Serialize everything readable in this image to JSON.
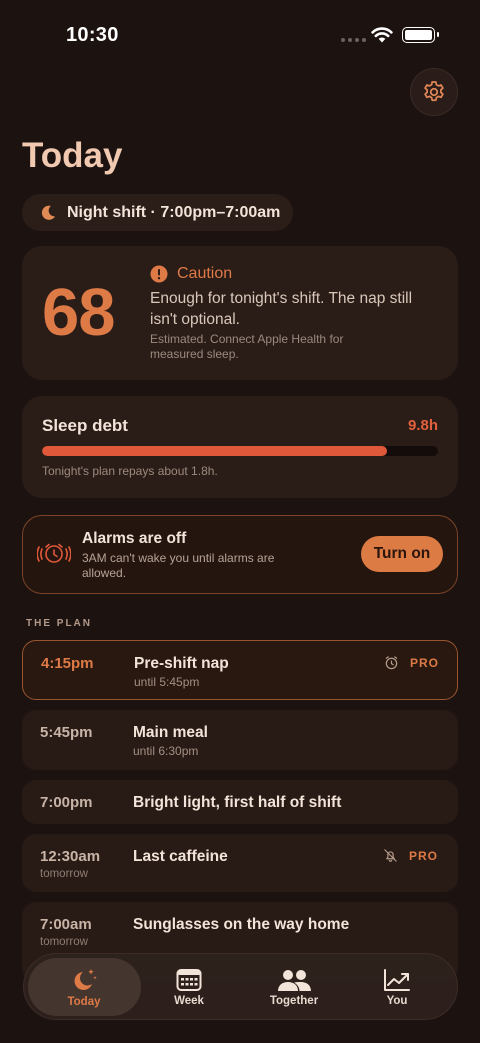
{
  "status_bar": {
    "time": "10:30"
  },
  "header": {
    "title": "Today"
  },
  "shift": {
    "label": "Night shift · 7:00pm–7:00am"
  },
  "score_card": {
    "score": "68",
    "status": "Caution",
    "message": "Enough for tonight's shift. The nap still isn't optional.",
    "note": "Estimated. Connect Apple Health for measured sleep."
  },
  "sleep_debt": {
    "title": "Sleep debt",
    "value": "9.8h",
    "fill_fraction": 0.87,
    "note": "Tonight's plan repays about 1.8h."
  },
  "alarm_banner": {
    "title": "Alarms are off",
    "description": "3AM can't wake you until alarms are allowed.",
    "button_label": "Turn on"
  },
  "plan": {
    "section_label": "THE PLAN",
    "items": [
      {
        "time": "4:15pm",
        "sub_time": "",
        "title": "Pre-shift nap",
        "until": "until 5:45pm",
        "icon": "alarm-clock-icon",
        "badge": "PRO",
        "active": true
      },
      {
        "time": "5:45pm",
        "sub_time": "",
        "title": "Main meal",
        "until": "until 6:30pm",
        "icon": "",
        "badge": "",
        "active": false
      },
      {
        "time": "7:00pm",
        "sub_time": "",
        "title": "Bright light, first half of shift",
        "until": "",
        "icon": "",
        "badge": "",
        "active": false
      },
      {
        "time": "12:30am",
        "sub_time": "tomorrow",
        "title": "Last caffeine",
        "until": "",
        "icon": "bell-off-icon",
        "badge": "PRO",
        "active": false
      },
      {
        "time": "7:00am",
        "sub_time": "tomorrow",
        "title": "Sunglasses on the way home",
        "until": "",
        "icon": "",
        "badge": "",
        "active": false
      }
    ]
  },
  "tab_bar": {
    "tabs": [
      {
        "label": "Today",
        "icon": "moon-stars-icon",
        "active": true
      },
      {
        "label": "Week",
        "icon": "calendar-icon",
        "active": false
      },
      {
        "label": "Together",
        "icon": "people-icon",
        "active": false
      },
      {
        "label": "You",
        "icon": "trend-chart-icon",
        "active": false
      }
    ]
  },
  "colors": {
    "accent": "#de7a46",
    "debt_bar": "#e0583a",
    "background": "#1c1210",
    "card": "#2a1c17"
  }
}
